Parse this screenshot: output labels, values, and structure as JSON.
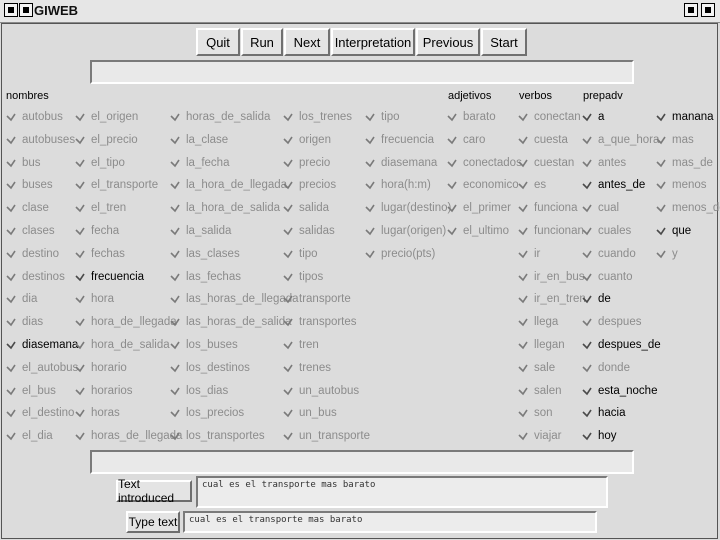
{
  "window": {
    "title": "GIWEB"
  },
  "toolbar": [
    "Quit",
    "Run",
    "Next",
    "Interpretation",
    "Previous",
    "Start"
  ],
  "headers": {
    "nombres": "nombres",
    "adjetivos": "adjetivos",
    "verbos": "verbos",
    "prepadv": "prepadv"
  },
  "columns": [
    {
      "items": [
        {
          "label": "autobus",
          "on": false
        },
        {
          "label": "autobuses",
          "on": false
        },
        {
          "label": "bus",
          "on": false
        },
        {
          "label": "buses",
          "on": false
        },
        {
          "label": "clase",
          "on": false
        },
        {
          "label": "clases",
          "on": false
        },
        {
          "label": "destino",
          "on": false
        },
        {
          "label": "destinos",
          "on": false
        },
        {
          "label": "dia",
          "on": false
        },
        {
          "label": "dias",
          "on": false
        },
        {
          "label": "diasemana",
          "on": true
        },
        {
          "label": "el_autobus",
          "on": false
        },
        {
          "label": "el_bus",
          "on": false
        },
        {
          "label": "el_destino",
          "on": false
        },
        {
          "label": "el_dia",
          "on": false
        }
      ]
    },
    {
      "items": [
        {
          "label": "el_origen",
          "on": false
        },
        {
          "label": "el_precio",
          "on": false
        },
        {
          "label": "el_tipo",
          "on": false
        },
        {
          "label": "el_transporte",
          "on": false
        },
        {
          "label": "el_tren",
          "on": false
        },
        {
          "label": "fecha",
          "on": false
        },
        {
          "label": "fechas",
          "on": false
        },
        {
          "label": "frecuencia",
          "on": true
        },
        {
          "label": "hora",
          "on": false
        },
        {
          "label": "hora_de_llegada",
          "on": false
        },
        {
          "label": "hora_de_salida",
          "on": false
        },
        {
          "label": "horario",
          "on": false
        },
        {
          "label": "horarios",
          "on": false
        },
        {
          "label": "horas",
          "on": false
        },
        {
          "label": "horas_de_llegada",
          "on": false
        }
      ]
    },
    {
      "items": [
        {
          "label": "horas_de_salida",
          "on": false
        },
        {
          "label": "la_clase",
          "on": false
        },
        {
          "label": "la_fecha",
          "on": false
        },
        {
          "label": "la_hora_de_llegada",
          "on": false
        },
        {
          "label": "la_hora_de_salida",
          "on": false
        },
        {
          "label": "la_salida",
          "on": false
        },
        {
          "label": "las_clases",
          "on": false
        },
        {
          "label": "las_fechas",
          "on": false
        },
        {
          "label": "las_horas_de_llegada",
          "on": false
        },
        {
          "label": "las_horas_de_salida",
          "on": false
        },
        {
          "label": "los_buses",
          "on": false
        },
        {
          "label": "los_destinos",
          "on": false
        },
        {
          "label": "los_dias",
          "on": false
        },
        {
          "label": "los_precios",
          "on": false
        },
        {
          "label": "los_transportes",
          "on": false
        }
      ]
    },
    {
      "items": [
        {
          "label": "los_trenes",
          "on": false
        },
        {
          "label": "origen",
          "on": false
        },
        {
          "label": "precio",
          "on": false
        },
        {
          "label": "precios",
          "on": false
        },
        {
          "label": "salida",
          "on": false
        },
        {
          "label": "salidas",
          "on": false
        },
        {
          "label": "tipo",
          "on": false
        },
        {
          "label": "tipos",
          "on": false
        },
        {
          "label": "transporte",
          "on": false
        },
        {
          "label": "transportes",
          "on": false
        },
        {
          "label": "tren",
          "on": false
        },
        {
          "label": "trenes",
          "on": false
        },
        {
          "label": "un_autobus",
          "on": false
        },
        {
          "label": "un_bus",
          "on": false
        },
        {
          "label": "un_transporte",
          "on": false
        }
      ]
    },
    {
      "items": [
        {
          "label": "tipo",
          "on": false
        },
        {
          "label": "frecuencia",
          "on": false
        },
        {
          "label": "diasemana",
          "on": false
        },
        {
          "label": "hora(h:m)",
          "on": false
        },
        {
          "label": "lugar(destino)",
          "on": false
        },
        {
          "label": "lugar(origen)",
          "on": false
        },
        {
          "label": "precio(pts)",
          "on": false
        }
      ]
    },
    {
      "items": [
        {
          "label": "barato",
          "on": false
        },
        {
          "label": "caro",
          "on": false
        },
        {
          "label": "conectados",
          "on": false
        },
        {
          "label": "economico",
          "on": false
        },
        {
          "label": "el_primer",
          "on": false
        },
        {
          "label": "el_ultimo",
          "on": false
        }
      ]
    },
    {
      "items": [
        {
          "label": "conectan",
          "on": false
        },
        {
          "label": "cuesta",
          "on": false
        },
        {
          "label": "cuestan",
          "on": false
        },
        {
          "label": "es",
          "on": false
        },
        {
          "label": "funciona",
          "on": false
        },
        {
          "label": "funcionan",
          "on": false
        },
        {
          "label": "ir",
          "on": false
        },
        {
          "label": "ir_en_bus",
          "on": false
        },
        {
          "label": "ir_en_tren",
          "on": false
        },
        {
          "label": "llega",
          "on": false
        },
        {
          "label": "llegan",
          "on": false
        },
        {
          "label": "sale",
          "on": false
        },
        {
          "label": "salen",
          "on": false
        },
        {
          "label": "son",
          "on": false
        },
        {
          "label": "viajar",
          "on": false
        }
      ]
    },
    {
      "items": [
        {
          "label": "a",
          "on": true
        },
        {
          "label": "a_que_hora",
          "on": false
        },
        {
          "label": "antes",
          "on": false
        },
        {
          "label": "antes_de",
          "on": true
        },
        {
          "label": "cual",
          "on": false
        },
        {
          "label": "cuales",
          "on": false
        },
        {
          "label": "cuando",
          "on": false
        },
        {
          "label": "cuanto",
          "on": false
        },
        {
          "label": "de",
          "on": true
        },
        {
          "label": "despues",
          "on": false
        },
        {
          "label": "despues_de",
          "on": true
        },
        {
          "label": "donde",
          "on": false
        },
        {
          "label": "esta_noche",
          "on": true
        },
        {
          "label": "hacia",
          "on": true
        },
        {
          "label": "hoy",
          "on": true
        }
      ]
    },
    {
      "items": [
        {
          "label": "manana",
          "on": true
        },
        {
          "label": "mas",
          "on": false
        },
        {
          "label": "mas_de",
          "on": false
        },
        {
          "label": "menos",
          "on": false
        },
        {
          "label": "menos_de",
          "on": false
        },
        {
          "label": "que",
          "on": true
        },
        {
          "label": "y",
          "on": false
        }
      ]
    }
  ],
  "bottom": {
    "text_introduced_label": "Text introduced",
    "text_introduced_value": "cual es el transporte mas barato",
    "type_text_label": "Type text",
    "type_text_value": "cual es el transporte mas barato"
  },
  "colors": {
    "active": "#000000",
    "inactive": "#8c8c8c",
    "background": "#dcdcdc"
  }
}
